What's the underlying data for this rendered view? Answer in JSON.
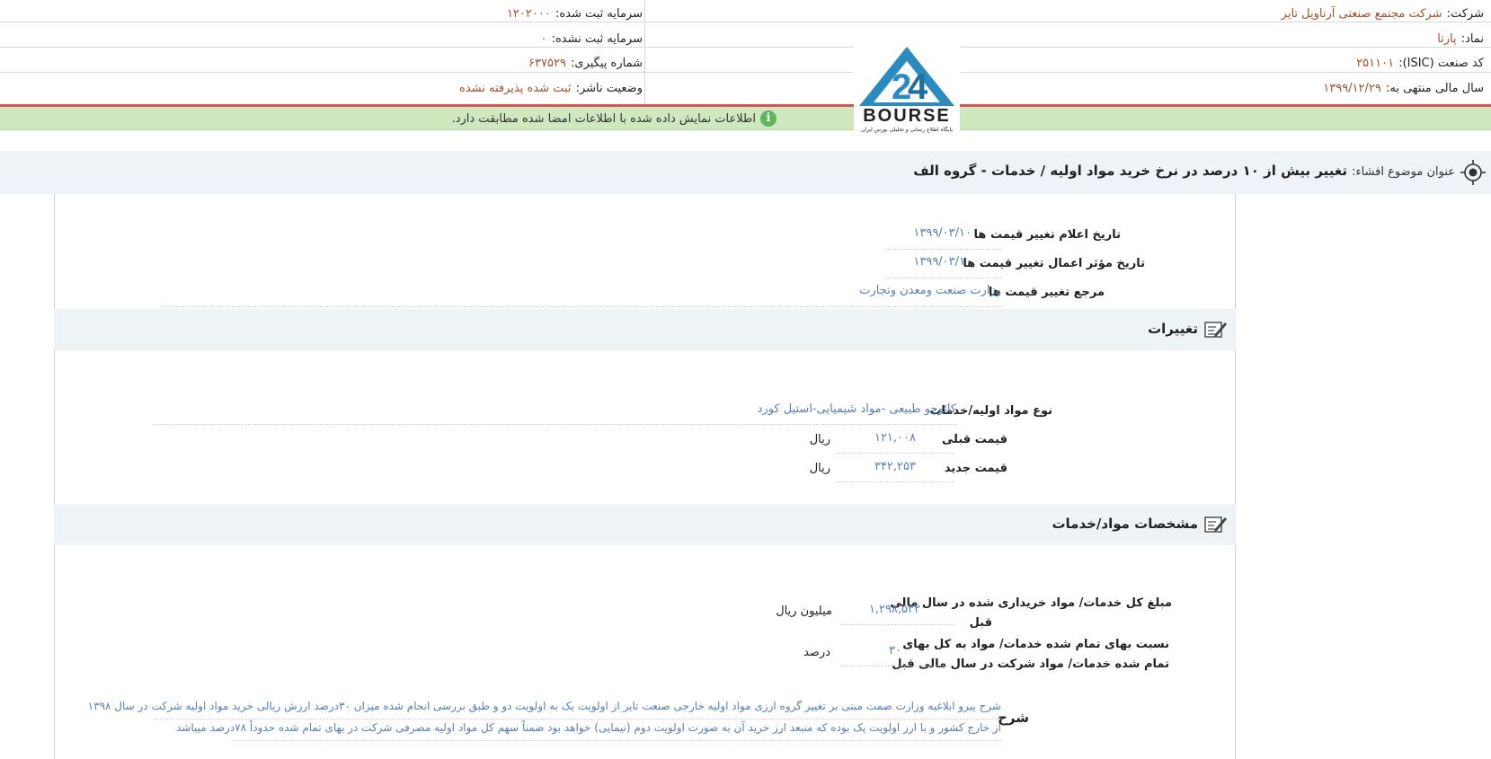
{
  "header": {
    "company_label": "شرکت:",
    "company_value": "شرکت مجتمع صنعتی آرتاویل تایر",
    "symbol_label": "نماد:",
    "symbol_value": "پارتا",
    "isic_label": "کد صنعت (ISIC):",
    "isic_value": "۲۵۱۱۰۱",
    "fiscal_year_label": "سال مالی منتهی به:",
    "fiscal_year_value": "۱۳۹۹/۱۲/۲۹",
    "registered_capital_label": "سرمایه ثبت شده:",
    "registered_capital_value": "۱۲۰۲۰۰۰",
    "unregistered_capital_label": "سرمایه ثبت نشده:",
    "unregistered_capital_value": "۰",
    "tracking_label": "شماره پیگیری:",
    "tracking_value": "۶۳۷۵۲۹",
    "publisher_status_label": "وضعیت ناشر:",
    "publisher_status_value": "ثبت شده پذیرفته نشده"
  },
  "logo": {
    "text": "BOURSE",
    "subtitle": "پایگاه اطلاع رسانی و تحلیلی بورس ایران"
  },
  "notice": {
    "text": "اطلاعات نمایش داده شده با اطلاعات امضا شده مطابقت دارد."
  },
  "topic": {
    "label": "عنوان موضوع افشاء:",
    "value": "تغییر بیش از ۱۰ درصد در نرخ خرید مواد اولیه / خدمات - گروه الف"
  },
  "dates": {
    "announce_label": "تاریخ اعلام تغییر قیمت ها",
    "announce_value": "۱۳۹۹/۰۳/۱۰",
    "effective_label": "تاریخ مؤثر اعمال تغییر قیمت ها",
    "effective_value": "۱۳۹۹/۰۳/۱۰",
    "reference_label": "مرجع تغییر قیمت ها",
    "reference_value": "وزارت صنعت ومعدن وتجارت"
  },
  "changes": {
    "title": "تغییرات",
    "material_type_label": "نوع مواد اولیه/خدمات",
    "material_type_value": "کائوچو طبیعی -مواد شیمیایی-استیل کورد",
    "old_price_label": "قیمت قبلی",
    "old_price_value": "۱۲۱,۰۰۸",
    "old_price_unit": "ریال",
    "new_price_label": "قیمت جدید",
    "new_price_value": "۳۴۲,۲۵۳",
    "new_price_unit": "ریال"
  },
  "specs": {
    "title": "مشخصات مواد/خدمات",
    "total_amount_label_1": "مبلغ کل خدمات/ مواد خریداری شده در سال مالی",
    "total_amount_label_2": "قبل",
    "total_amount_value": "۱,۲۹۸,۵۳۲",
    "total_amount_unit": "میلیون ریال",
    "ratio_label_1": "نسبت بهای تمام شده خدمات/ مواد به کل بهای",
    "ratio_label_2": "تمام شده خدمات/ مواد شرکت در سال مالی قبل",
    "ratio_value": "۳۰",
    "ratio_unit": "درصد"
  },
  "description": {
    "label": "شرح",
    "line1": "شرح پیرو ابلاغیه وزارت صمت مبنی بر تغییر گروه ارزی مواد اولیه خارجی صنعت تایر از اولویت یک به اولویت دو و طبق بررسی انجام شده میزان ۳۰درصد ارزش ریالی خرید مواد اولیه شرکت در سال ۱۳۹۸",
    "line2": "از خارج کشور و با ارز اولویت یک بوده که منبعد ارز خرید آن به صورت اولویت دوم (نیمایی) خواهد بود ضمناً سهم کل مواد اولیه مصرفی شرکت در بهای تمام شده حدوداً ۷۸درصد میباشد"
  },
  "colors": {
    "header_value": "#a0522d",
    "field_value": "#5a7fb4",
    "notice_bg": "#cfe8bf",
    "banner_bg": "#eef3f8",
    "red_line": "#d9534f",
    "logo_blue": "#2a8bc0"
  },
  "icons": {
    "info": "info-circle-icon",
    "topic": "target-icon",
    "section": "edit-note-icon"
  }
}
